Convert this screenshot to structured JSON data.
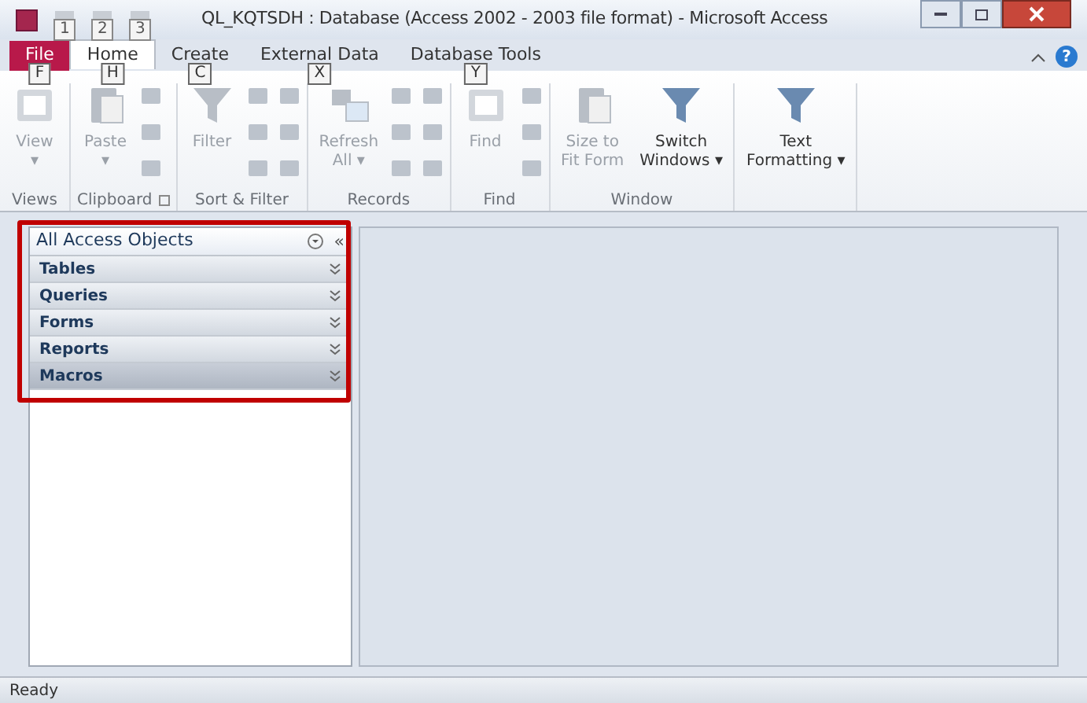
{
  "window": {
    "title": "QL_KQTSDH : Database (Access 2002 - 2003 file format)  -  Microsoft Access"
  },
  "quick_access": {
    "keytips": [
      "1",
      "2",
      "3"
    ]
  },
  "tabs": [
    {
      "label": "File",
      "keytip": "F",
      "selected": false,
      "kind": "file"
    },
    {
      "label": "Home",
      "keytip": "H",
      "selected": true,
      "kind": "tab"
    },
    {
      "label": "Create",
      "keytip": "C",
      "selected": false,
      "kind": "tab"
    },
    {
      "label": "External Data",
      "keytip": "X",
      "selected": false,
      "kind": "tab"
    },
    {
      "label": "Database Tools",
      "keytip": "Y",
      "selected": false,
      "kind": "tab"
    }
  ],
  "help": {
    "label": "?"
  },
  "ribbon_groups": [
    {
      "label": "Views",
      "buttons": [
        {
          "label": "View",
          "sub": "▾",
          "disabled": true
        }
      ]
    },
    {
      "label": "Clipboard",
      "launcher": true,
      "buttons": [
        {
          "label": "Paste",
          "sub": "▾",
          "disabled": true
        }
      ]
    },
    {
      "label": "Sort & Filter",
      "buttons": [
        {
          "label": "Filter",
          "disabled": true
        }
      ]
    },
    {
      "label": "Records",
      "buttons": [
        {
          "label": "Refresh",
          "sub": "All ▾",
          "disabled": true
        }
      ]
    },
    {
      "label": "Find",
      "buttons": [
        {
          "label": "Find",
          "disabled": true
        }
      ]
    },
    {
      "label": "Window",
      "buttons": [
        {
          "label": "Size to",
          "sub": "Fit Form",
          "disabled": true
        },
        {
          "label": "Switch",
          "sub": "Windows ▾",
          "disabled": false
        }
      ]
    },
    {
      "buttons": [
        {
          "label": "Text",
          "sub": "Formatting ▾",
          "disabled": false
        }
      ]
    }
  ],
  "navigation_pane": {
    "title": "All Access Objects",
    "collapse": "«",
    "groups": [
      {
        "label": "Tables",
        "selected": false
      },
      {
        "label": "Queries",
        "selected": false
      },
      {
        "label": "Forms",
        "selected": false
      },
      {
        "label": "Reports",
        "selected": false
      },
      {
        "label": "Macros",
        "selected": true
      }
    ]
  },
  "status_bar": {
    "text": "Ready"
  }
}
